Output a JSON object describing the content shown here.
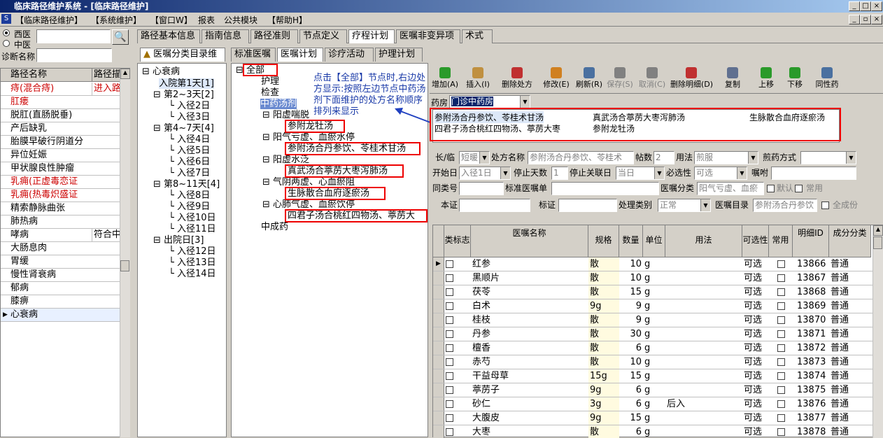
{
  "window": {
    "title": "临床路径维护系统 - [临床路径维护]"
  },
  "menu": {
    "items": [
      "【临床路径维护】",
      "【系统维护】",
      "【窗口W】",
      "报表",
      "公共模块",
      "【帮助H】"
    ]
  },
  "left": {
    "radio_western": "西医",
    "radio_chinese": "中医",
    "diag_label": "诊断名称",
    "col_name": "路径名称",
    "col_desc": "路径描",
    "rows": [
      {
        "name": "痔(混合痔)",
        "desc": "进入路",
        "red": true
      },
      {
        "name": "肛瘘",
        "desc": "",
        "red": true
      },
      {
        "name": "脱肛(直肠脱垂)",
        "desc": "",
        "red": false
      },
      {
        "name": "产后缺乳",
        "desc": "",
        "red": false
      },
      {
        "name": "胎膜早破行阴道分",
        "desc": "",
        "red": false
      },
      {
        "name": "异位妊娠",
        "desc": "",
        "red": false
      },
      {
        "name": "甲状腺良性肿瘤",
        "desc": "",
        "red": false
      },
      {
        "name": "乳痈(正虚毒恋证",
        "desc": "",
        "red": true
      },
      {
        "name": "乳痈(热毒炽盛证",
        "desc": "",
        "red": true
      },
      {
        "name": "精索静脉曲张",
        "desc": "",
        "red": false
      },
      {
        "name": "肺热病",
        "desc": "",
        "red": false
      },
      {
        "name": "哮病",
        "desc": "符合中",
        "red": false
      },
      {
        "name": "大肠息肉",
        "desc": "",
        "red": false
      },
      {
        "name": "胃缓",
        "desc": "",
        "red": false
      },
      {
        "name": "慢性肾衰病",
        "desc": "",
        "red": false
      },
      {
        "name": "郁病",
        "desc": "",
        "red": false
      },
      {
        "name": "膝痹",
        "desc": "",
        "red": false
      },
      {
        "name": "心衰病",
        "desc": "",
        "red": false
      }
    ]
  },
  "tabs_top": [
    "路径基本信息",
    "指南信息",
    "路径准则",
    "节点定义",
    "疗程计划",
    "医嘱非变异项",
    "术式"
  ],
  "tabs_second": [
    "医嘱分类目录维",
    "标准医嘱",
    "医嘱计划",
    "诊疗活动",
    "护理计划"
  ],
  "tree1": {
    "root": "心衰病",
    "nodes": [
      {
        "t": "入院第1天[1]",
        "l": 1
      },
      {
        "t": "第2~3天[2]",
        "l": 1
      },
      {
        "t": "入径2日",
        "l": 2
      },
      {
        "t": "入径3日",
        "l": 2
      },
      {
        "t": "第4~7天[4]",
        "l": 1
      },
      {
        "t": "入径4日",
        "l": 2
      },
      {
        "t": "入径5日",
        "l": 2
      },
      {
        "t": "入径6日",
        "l": 2
      },
      {
        "t": "入径7日",
        "l": 2
      },
      {
        "t": "第8~11天[4]",
        "l": 1
      },
      {
        "t": "入径8日",
        "l": 2
      },
      {
        "t": "入径9日",
        "l": 2
      },
      {
        "t": "入径10日",
        "l": 2
      },
      {
        "t": "入径11日",
        "l": 2
      },
      {
        "t": "出院日[3]",
        "l": 1
      },
      {
        "t": "入径12日",
        "l": 2
      },
      {
        "t": "入径13日",
        "l": 2
      },
      {
        "t": "入径14日",
        "l": 2
      }
    ]
  },
  "tree2": {
    "root": "全部",
    "nursing": "护理",
    "check": "检查",
    "cm": "中药汤剂",
    "groups": [
      {
        "g": "阳虚喘脱",
        "item": "参附龙牡汤"
      },
      {
        "g": "阳气亏虚、血瘀水停",
        "item": "参附汤合丹参饮、苓桂术甘汤"
      },
      {
        "g": "阳虚水泛",
        "item": "真武汤合葶苈大枣泻肺汤"
      },
      {
        "g": "气阴两虚、心血瘀阻",
        "item": "生脉散合血府逐瘀汤"
      },
      {
        "g": "心肺气虚、血瘀饮停",
        "item": "四君子汤合桃红四物汤、葶苈大"
      }
    ],
    "tail": "中成药"
  },
  "annotation": {
    "text": "点击【全部】节点时,右边处方显示:按照左边节点中药汤剂下面维护的处方名称顺序排列来显示"
  },
  "toolbar": [
    "增加(A)",
    "插入(I)",
    "删除处方",
    "修改(E)",
    "刷新(R)",
    "保存(S)",
    "取消(C)",
    "删除明细(D)",
    "复制",
    "上移",
    "下移",
    "同性药"
  ],
  "pharmacy": {
    "label": "药房",
    "value": "门诊中药房"
  },
  "prescriptions": [
    "参附汤合丹参饮、苓桂术甘汤",
    "真武汤合葶苈大枣泻肺汤",
    "生脉散合血府逐瘀汤",
    "四君子汤合桃红四物汤、葶苈大枣",
    "参附龙牡汤"
  ],
  "form": {
    "long_label": "长/临",
    "long_val": "短暖",
    "rx_label": "处方名称",
    "rx_val": "参附汤合丹参饮、苓桂术",
    "doses_label": "帖数",
    "doses_val": "2",
    "usage_label": "用法",
    "usage_val": "煎服",
    "decoct_label": "煎药方式",
    "start_label": "开始日",
    "start_val": "入径1日",
    "stop_label": "停止天数",
    "stop_val": "1",
    "stoplink_label": "停止关联日",
    "stoplink_val": "当日",
    "must_label": "必选性",
    "must_val": "可选",
    "note_label": "嘱咐",
    "same_label": "同类号",
    "std_label": "标准医嘱单",
    "cat_label": "医嘱分类",
    "cat_val": "阳气亏虚、血瘀",
    "default_label": "默认",
    "common_label": "常用",
    "cert_label": "本证",
    "mark_label": "标证",
    "proc_label": "处理类别",
    "proc_val": "正常",
    "dir_label": "医嘱目录",
    "dir_val": "参附汤合丹参饮",
    "all_label": "全成份"
  },
  "grid": {
    "headers": [
      "类标志",
      "医嘱名称",
      "规格",
      "数量",
      "单位",
      "用法",
      "可选性",
      "常用",
      "明细ID",
      "成分分类"
    ],
    "rows": [
      {
        "n": "红参",
        "s": "散",
        "q": "10",
        "u": "g",
        "use": "",
        "o": "可选",
        "id": "13866",
        "c": "普通"
      },
      {
        "n": "黑顺片",
        "s": "散",
        "q": "10",
        "u": "g",
        "use": "",
        "o": "可选",
        "id": "13867",
        "c": "普通"
      },
      {
        "n": "茯苓",
        "s": "散",
        "q": "15",
        "u": "g",
        "use": "",
        "o": "可选",
        "id": "13868",
        "c": "普通"
      },
      {
        "n": "白术",
        "s": "9g",
        "q": "9",
        "u": "g",
        "use": "",
        "o": "可选",
        "id": "13869",
        "c": "普通"
      },
      {
        "n": "桂枝",
        "s": "散",
        "q": "9",
        "u": "g",
        "use": "",
        "o": "可选",
        "id": "13870",
        "c": "普通"
      },
      {
        "n": "丹参",
        "s": "散",
        "q": "30",
        "u": "g",
        "use": "",
        "o": "可选",
        "id": "13871",
        "c": "普通"
      },
      {
        "n": "檀香",
        "s": "散",
        "q": "6",
        "u": "g",
        "use": "",
        "o": "可选",
        "id": "13872",
        "c": "普通"
      },
      {
        "n": "赤芍",
        "s": "散",
        "q": "10",
        "u": "g",
        "use": "",
        "o": "可选",
        "id": "13873",
        "c": "普通"
      },
      {
        "n": "干益母草",
        "s": "15g",
        "q": "15",
        "u": "g",
        "use": "",
        "o": "可选",
        "id": "13874",
        "c": "普通"
      },
      {
        "n": "葶苈子",
        "s": "9g",
        "q": "6",
        "u": "g",
        "use": "",
        "o": "可选",
        "id": "13875",
        "c": "普通"
      },
      {
        "n": "砂仁",
        "s": "3g",
        "q": "6",
        "u": "g",
        "use": "后入",
        "o": "可选",
        "id": "13876",
        "c": "普通"
      },
      {
        "n": "大腹皮",
        "s": "9g",
        "q": "15",
        "u": "g",
        "use": "",
        "o": "可选",
        "id": "13877",
        "c": "普通"
      },
      {
        "n": "大枣",
        "s": "散",
        "q": "6",
        "u": "g",
        "use": "",
        "o": "可选",
        "id": "13878",
        "c": "普通"
      }
    ]
  }
}
